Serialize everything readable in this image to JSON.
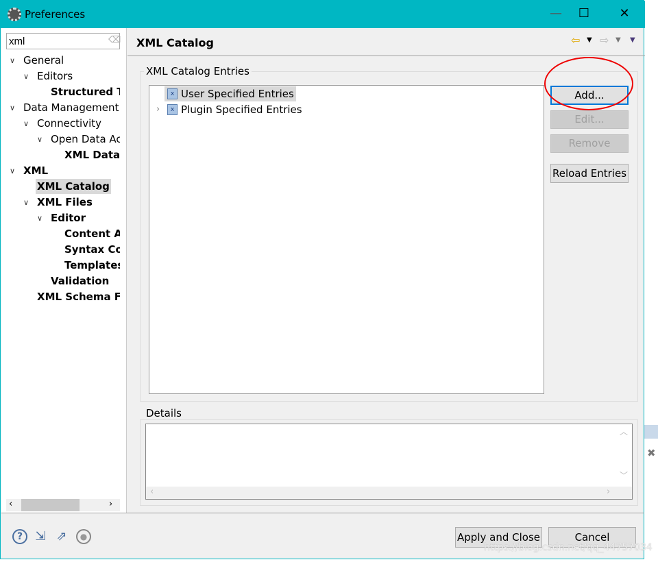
{
  "window": {
    "title": "Preferences",
    "minimize": "—",
    "maximize": "☐",
    "close": "✕",
    "accent": "#00b7c3"
  },
  "sidebar": {
    "filter_value": "xml",
    "items": [
      {
        "label": "General",
        "level": 0,
        "expanded": true,
        "bold": false
      },
      {
        "label": "Editors",
        "level": 1,
        "expanded": true,
        "bold": false
      },
      {
        "label": "Structured Te",
        "level": 2,
        "bold": true
      },
      {
        "label": "Data Management",
        "level": 0,
        "expanded": true,
        "bold": false
      },
      {
        "label": "Connectivity",
        "level": 1,
        "expanded": true,
        "bold": false
      },
      {
        "label": "Open Data Ac",
        "level": 2,
        "expanded": true,
        "bold": false
      },
      {
        "label": "XML Data S",
        "level": 3,
        "bold": true
      },
      {
        "label": "XML",
        "level": 0,
        "expanded": true,
        "bold": true
      },
      {
        "label": "XML Catalog",
        "level": 1,
        "bold": true,
        "selected": true
      },
      {
        "label": "XML Files",
        "level": 1,
        "expanded": true,
        "bold": true
      },
      {
        "label": "Editor",
        "level": 2,
        "expanded": true,
        "bold": true
      },
      {
        "label": "Content As",
        "level": 3,
        "bold": true
      },
      {
        "label": "Syntax Col",
        "level": 3,
        "bold": true
      },
      {
        "label": "Templates",
        "level": 3,
        "bold": true
      },
      {
        "label": "Validation",
        "level": 2,
        "bold": true
      },
      {
        "label": "XML Schema File",
        "level": 1,
        "bold": true
      }
    ]
  },
  "main": {
    "title": "XML Catalog",
    "entries_group": "XML Catalog Entries",
    "entries": [
      {
        "label": "User Specified Entries",
        "selected": true,
        "expandable": false
      },
      {
        "label": "Plugin Specified Entries",
        "selected": false,
        "expandable": true
      }
    ],
    "buttons": {
      "add": "Add...",
      "edit": "Edit...",
      "remove": "Remove",
      "reload": "Reload Entries"
    },
    "details_group": "Details"
  },
  "footer": {
    "apply_close": "Apply and Close",
    "cancel": "Cancel"
  },
  "watermark": "https://blog.csdn.net/qq_44757034"
}
